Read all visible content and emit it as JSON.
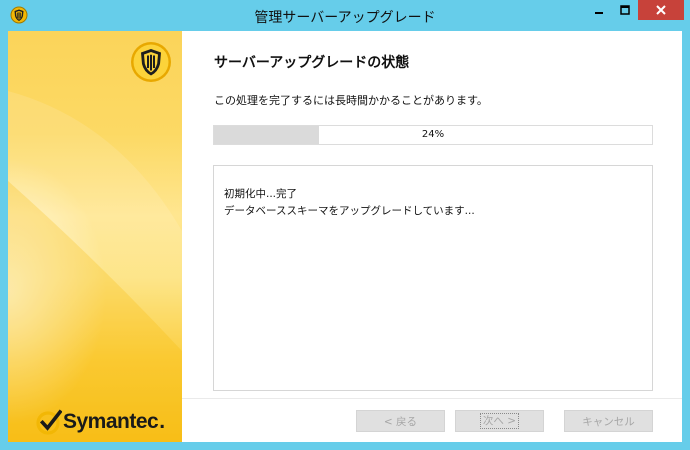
{
  "window": {
    "title": "管理サーバーアップグレード",
    "minimize_glyph": "—",
    "maximize_glyph": "□",
    "close_glyph": "✕"
  },
  "brand": {
    "name": "Symantec",
    "mark": "."
  },
  "main": {
    "heading": "サーバーアップグレードの状態",
    "description": "この処理を完了するには長時間かかることがあります。",
    "progress": {
      "percent": 24,
      "label": "24%"
    },
    "log": [
      "初期化中...完了",
      "データベーススキーマをアップグレードしています..."
    ]
  },
  "buttons": {
    "back": "< 戻る",
    "next": "次へ >",
    "cancel": "キャンセル"
  },
  "colors": {
    "titlebar": "#66cdea",
    "close": "#c7423a",
    "sidebar_accent": "#fbc928",
    "progress_fill": "#dadada"
  },
  "icons": [
    "shield-icon",
    "symantec-check-icon",
    "minimize-icon",
    "maximize-icon",
    "close-icon"
  ]
}
